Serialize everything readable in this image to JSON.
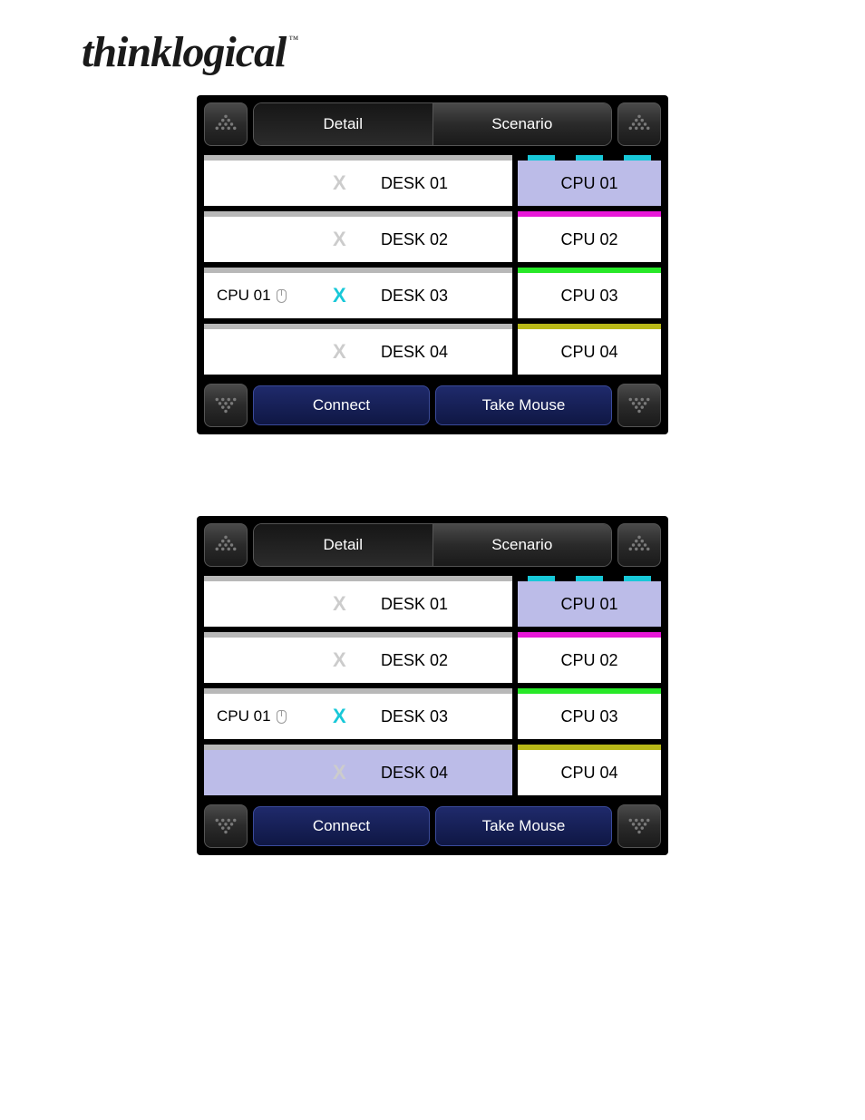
{
  "brand": {
    "name": "thinklogical",
    "mark": "™"
  },
  "tabs": {
    "detail": "Detail",
    "scenario": "Scenario"
  },
  "actions": {
    "connect": "Connect",
    "take_mouse": "Take Mouse"
  },
  "colors": {
    "cpu01": "#18c8d8",
    "cpu02": "#e818d8",
    "cpu03": "#28e828",
    "cpu04": "#b8b818"
  },
  "panels": [
    {
      "rows": [
        {
          "desk": "DESK 01",
          "conn_cpu": "",
          "has_mouse": false,
          "x_active": false,
          "desk_selected": false,
          "cpu": "CPU 01",
          "cpu_selected": true,
          "cpu_color_key": "cpu01",
          "cpu_dashed": true
        },
        {
          "desk": "DESK 02",
          "conn_cpu": "",
          "has_mouse": false,
          "x_active": false,
          "desk_selected": false,
          "cpu": "CPU 02",
          "cpu_selected": false,
          "cpu_color_key": "cpu02",
          "cpu_dashed": false
        },
        {
          "desk": "DESK 03",
          "conn_cpu": "CPU 01",
          "has_mouse": true,
          "x_active": true,
          "desk_selected": false,
          "cpu": "CPU 03",
          "cpu_selected": false,
          "cpu_color_key": "cpu03",
          "cpu_dashed": false
        },
        {
          "desk": "DESK 04",
          "conn_cpu": "",
          "has_mouse": false,
          "x_active": false,
          "desk_selected": false,
          "cpu": "CPU 04",
          "cpu_selected": false,
          "cpu_color_key": "cpu04",
          "cpu_dashed": false
        }
      ]
    },
    {
      "rows": [
        {
          "desk": "DESK 01",
          "conn_cpu": "",
          "has_mouse": false,
          "x_active": false,
          "desk_selected": false,
          "cpu": "CPU 01",
          "cpu_selected": true,
          "cpu_color_key": "cpu01",
          "cpu_dashed": true
        },
        {
          "desk": "DESK 02",
          "conn_cpu": "",
          "has_mouse": false,
          "x_active": false,
          "desk_selected": false,
          "cpu": "CPU 02",
          "cpu_selected": false,
          "cpu_color_key": "cpu02",
          "cpu_dashed": false
        },
        {
          "desk": "DESK 03",
          "conn_cpu": "CPU 01",
          "has_mouse": true,
          "x_active": true,
          "desk_selected": false,
          "cpu": "CPU 03",
          "cpu_selected": false,
          "cpu_color_key": "cpu03",
          "cpu_dashed": false
        },
        {
          "desk": "DESK 04",
          "conn_cpu": "",
          "has_mouse": false,
          "x_active": false,
          "desk_selected": true,
          "cpu": "CPU 04",
          "cpu_selected": false,
          "cpu_color_key": "cpu04",
          "cpu_dashed": false
        }
      ]
    }
  ]
}
